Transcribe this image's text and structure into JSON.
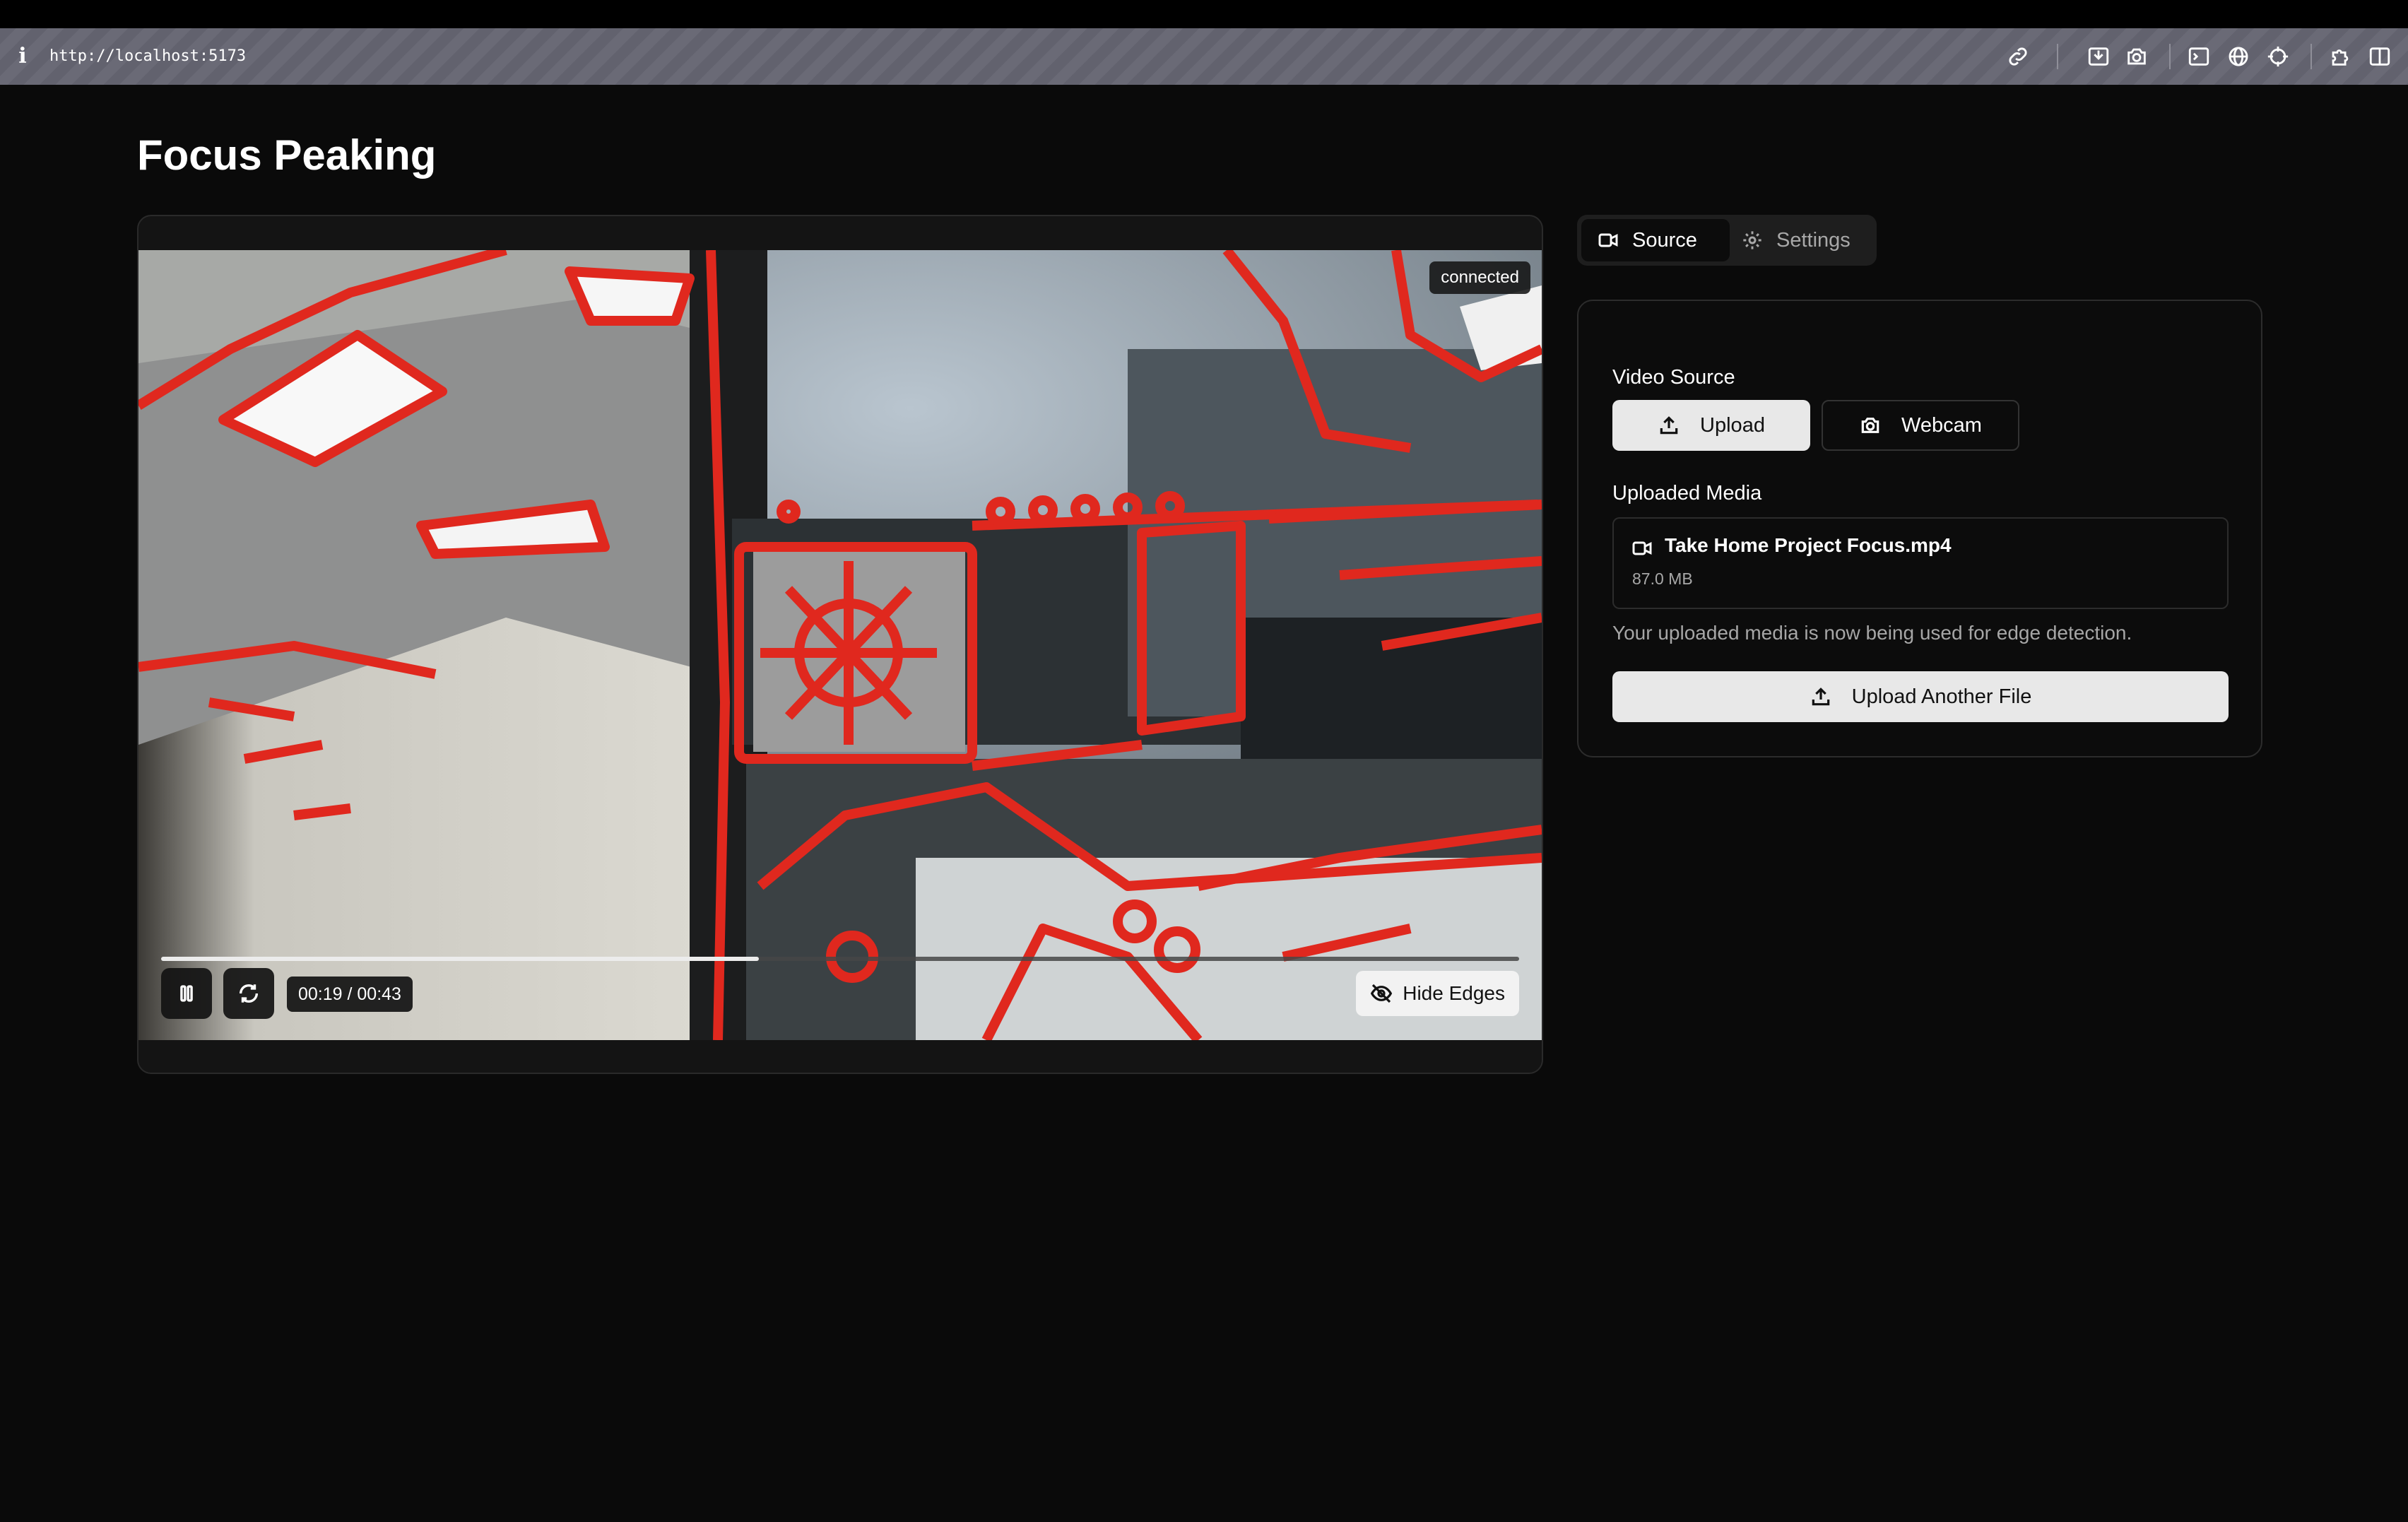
{
  "browser": {
    "url": "http://localhost:5173",
    "icons": [
      "info-icon",
      "link-icon",
      "save-icon",
      "camera-icon",
      "terminal-icon",
      "globe-icon",
      "crosshair-icon",
      "puzzle-icon",
      "sidebar-icon"
    ]
  },
  "page": {
    "title": "Focus Peaking"
  },
  "player": {
    "status": "connected",
    "time": "00:19 / 00:43",
    "progress": 0.44,
    "hide_edges_label": "Hide Edges",
    "edge_color": "#e0281e"
  },
  "tabs": {
    "source": "Source",
    "settings": "Settings"
  },
  "panel": {
    "video_source_label": "Video Source",
    "upload_label": "Upload",
    "webcam_label": "Webcam",
    "uploaded_media_label": "Uploaded Media",
    "file_name": "Take Home Project Focus.mp4",
    "file_size": "87.0 MB",
    "helper": "Your uploaded media is now being used for edge detection.",
    "upload_another_label": "Upload Another File"
  }
}
